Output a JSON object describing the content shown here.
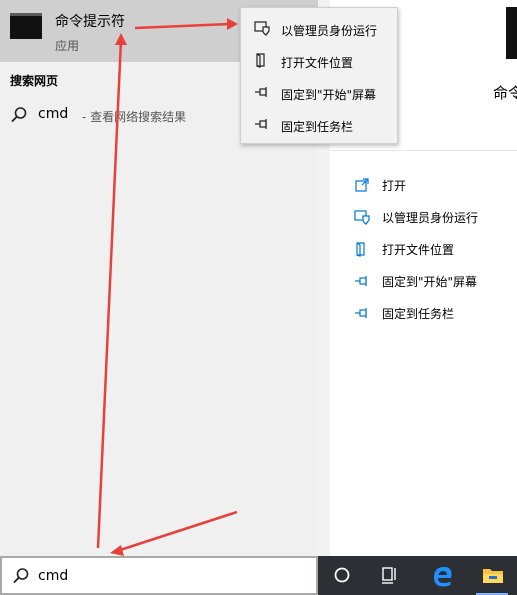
{
  "best_match": {
    "app_name": "命令提示符",
    "app_type": "应用",
    "icon": "console-app-icon"
  },
  "web_section": {
    "title": "搜索网页",
    "query": "cmd",
    "suffix": "- 查看网络搜索结果",
    "icon": "search-icon"
  },
  "context_menu": {
    "items": [
      {
        "label": "以管理员身份运行",
        "icon": "shield-run-icon"
      },
      {
        "label": "打开文件位置",
        "icon": "file-location-icon"
      },
      {
        "label": "固定到\"开始\"屏幕",
        "icon": "pin-icon"
      },
      {
        "label": "固定到任务栏",
        "icon": "pin-icon"
      }
    ]
  },
  "preview": {
    "app_name": "命令",
    "icon": "console-app-icon",
    "actions": [
      {
        "label": "打开",
        "icon": "open-icon"
      },
      {
        "label": "以管理员身份运行",
        "icon": "shield-run-icon"
      },
      {
        "label": "打开文件位置",
        "icon": "file-location-icon"
      },
      {
        "label": "固定到\"开始\"屏幕",
        "icon": "pin-icon"
      },
      {
        "label": "固定到任务栏",
        "icon": "pin-icon"
      }
    ]
  },
  "search": {
    "value": "cmd",
    "icon": "search-icon"
  },
  "taskbar": {
    "buttons": [
      "cortana-icon",
      "task-view-icon",
      "edge-icon",
      "file-explorer-icon"
    ]
  },
  "colors": {
    "accent": "#0078d7",
    "annotation": "#e8413c",
    "taskbar": "#2c2f33",
    "selection": "#cfcfcf"
  }
}
